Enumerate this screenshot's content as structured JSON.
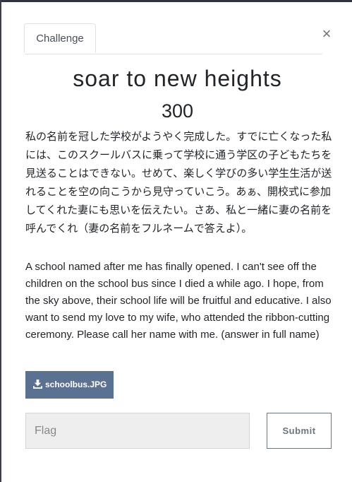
{
  "modal": {
    "close_symbol": "×",
    "tab_label": "Challenge",
    "challenge_name": "soar to new heights",
    "challenge_value": "300",
    "description_ja": "私の名前を冠した学校がようやく完成した。すでに亡くなった私には、このスクールバスに乗って学校に通う学区の子どもたちを見送ることはできない。せめて、楽しく学びの多い学生生活が送れることを空の向こうから見守っていこう。あぁ、開校式に参加してくれた妻にも思いを伝えたい。さあ、私と一緒に妻の名前を呼んでくれ（妻の名前をフルネームで答えよ）。",
    "description_en": "A school named after me has finally opened. I can't see off the children on the school bus since I died a while ago. I hope, from the sky above, their school life will be fruitful and educative. I also want to send my love to my wife, who attended the ribbon-cutting ceremony. Please call her name with me. (answer in full name)",
    "file": {
      "label": "schoolbus.JPG",
      "icon": "download-icon"
    },
    "flag_input": {
      "value": "",
      "placeholder": "Flag"
    },
    "submit_label": "Submit"
  },
  "colors": {
    "file_button": "#5a7192",
    "input_background": "#eeeeee",
    "submit_border": "#6c757d",
    "text": "#212529"
  }
}
